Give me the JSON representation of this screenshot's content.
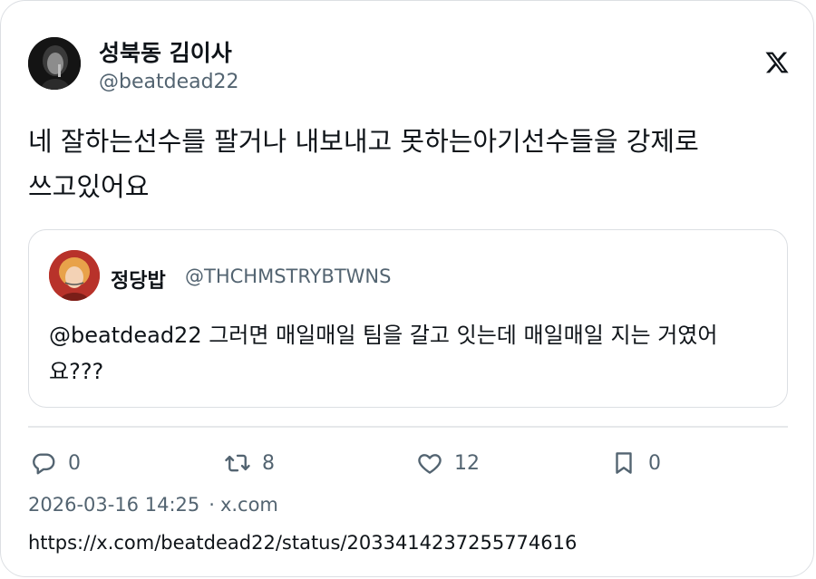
{
  "author": {
    "display_name": "성북동 김이사",
    "handle": "@beatdead22"
  },
  "tweet": {
    "text": "네 잘하는선수를 팔거나 내보내고 못하는아기선수들을 강제로 쓰고있어요"
  },
  "quoted": {
    "display_name": "정당밥",
    "handle": "@THCHMSTRYBTWNS",
    "text": "@beatdead22 그러면 매일매일 팀을 갈고 잇는데 매일매일 지는 거였어요???"
  },
  "actions": {
    "reply_count": "0",
    "retweet_count": "8",
    "like_count": "12",
    "bookmark_count": "0"
  },
  "meta": {
    "timestamp": "2026-03-16 14:25",
    "separator": "·",
    "source": "x.com"
  },
  "url": "https://x.com/beatdead22/status/2033414237255774616",
  "icons": {
    "logo": "x-logo-icon",
    "reply": "reply-icon",
    "retweet": "retweet-icon",
    "like": "heart-icon",
    "bookmark": "bookmark-icon"
  },
  "colors": {
    "text_primary": "#0f1419",
    "text_secondary": "#536471",
    "border": "#dcdfe3"
  }
}
